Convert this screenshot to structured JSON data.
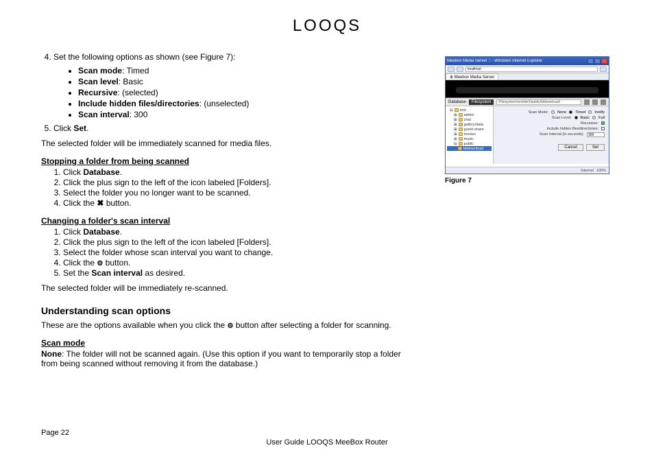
{
  "logo": "LOOQS",
  "step4": {
    "intro": "Set the following options as shown (see Figure 7):",
    "opts": [
      {
        "label": "Scan mode",
        "val": ":  Timed"
      },
      {
        "label": "Scan level",
        "val": ":  Basic"
      },
      {
        "label": "Recursive",
        "val": ":  (selected)"
      },
      {
        "label": "Include hidden files/directories",
        "val": ":  (unselected)"
      },
      {
        "label": "Scan interval",
        "val": ":  300"
      }
    ]
  },
  "step5": {
    "pre": "Click ",
    "b": "Set",
    "post": "."
  },
  "para1": "The selected folder will be immediately scanned for media files.",
  "stop": {
    "heading": "Stopping a folder from being scanned",
    "s1a": "Click ",
    "s1b": "Database",
    "s1c": ".",
    "s2": "Click the plus sign to the left of the icon labeled [Folders].",
    "s3": " Select the folder you no longer want to be scanned.",
    "s4a": "Click the ",
    "s4icon": "✖",
    "s4b": " button."
  },
  "change": {
    "heading": "Changing a folder's scan interval",
    "s1a": "Click ",
    "s1b": "Database",
    "s1c": ".",
    "s2": "Click the plus sign to the left of the icon labeled [Folders].",
    "s3": "Select the folder whose scan interval you want to change.",
    "s4a": "Click the ",
    "s4icon": "⚙",
    "s4b": " button.",
    "s5a": "Set the ",
    "s5b": "Scan interval",
    "s5c": " as desired."
  },
  "para2": "The selected folder will be immediately re-scanned.",
  "section": "Understanding scan options",
  "sectP1a": "These are the options available when you click the ",
  "sectIcon": "⚙",
  "sectP1b": " button after selecting a folder for scanning.",
  "scanmode": {
    "heading": "Scan mode",
    "b": "None",
    "txt": ":  The folder will not be scanned again. (Use this option if you want to temporarily stop a folder from being scanned without removing it from the database.)"
  },
  "fig": {
    "title": "Meebox Media Server :: - Windows Internet Explorer",
    "addr": "localhost",
    "tab": "⊕ Meebox Media Server",
    "dblabel": "Database",
    "dbtab": "Filesystem",
    "path": "/Filesystem/mnt/ide3/public/bitdownload/",
    "tree": [
      "mnt",
      "admin",
      "chat",
      "gallery/data",
      "guest-share",
      "movies",
      "music",
      "public",
      "bitdownload"
    ],
    "panel": {
      "scanmode": "Scan Mode:",
      "smopts": [
        "None",
        "Timed",
        "Inotify"
      ],
      "scanlevel": "Scan Level:",
      "slopts": [
        "Basic",
        "Full"
      ],
      "recursive": "Recursive:",
      "hidden": "Include hidden files/directories:",
      "interval": "Scan Interval (in seconds):",
      "intval": "300",
      "cancel": "Cancel",
      "set": "Set"
    },
    "status": "Internet",
    "zoom": "100%",
    "caption": "Figure 7"
  },
  "footer": {
    "page": "Page 22",
    "guide": "User Guide LOOQS MeeBox Router"
  }
}
